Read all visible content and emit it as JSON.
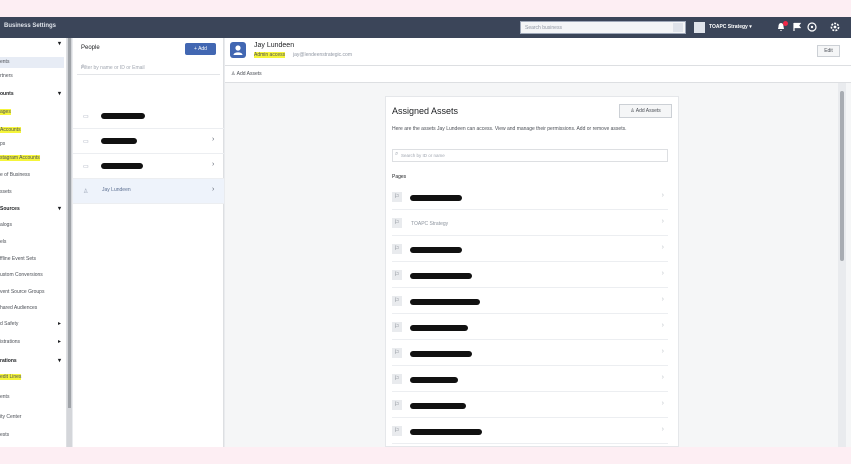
{
  "app": {
    "title": "Business Settings"
  },
  "topbar": {
    "search_placeholder": "Search business",
    "business_name": "TOAPC Strategy",
    "icons": [
      "chevron-down-icon",
      "notifications-icon",
      "flag-icon",
      "help-icon",
      "settings-icon"
    ]
  },
  "sidebar": {
    "items": [
      {
        "label": "",
        "head": true,
        "chev": "▾"
      },
      {
        "label": "ents",
        "active": true
      },
      {
        "label": "rtners"
      },
      {
        "label": "ounts",
        "head": true,
        "chev": "▾"
      },
      {
        "label": "ages",
        "highlight": true
      },
      {
        "label": "Accounts",
        "highlight": true
      },
      {
        "label": "ps"
      },
      {
        "label": "stagram Accounts",
        "highlight": true
      },
      {
        "label": "e of Business"
      },
      {
        "label": "ssets"
      },
      {
        "label": "Sources",
        "head": true,
        "chev": "▾"
      },
      {
        "label": "alogs"
      },
      {
        "label": "els"
      },
      {
        "label": "ffline Event Sets"
      },
      {
        "label": "ustom Conversions"
      },
      {
        "label": "vent Source Groups"
      },
      {
        "label": "hared Audiences"
      },
      {
        "label": "d Safety",
        "chev": "▸"
      },
      {
        "label": "istrations",
        "chev": "▸"
      },
      {
        "label": "rations",
        "head": true,
        "chev": "▾"
      },
      {
        "label": "edit Lines",
        "highlight": true
      },
      {
        "label": "ents"
      },
      {
        "label": "ity Center"
      },
      {
        "label": "ests"
      }
    ]
  },
  "people_panel": {
    "title": "People",
    "add_label": "+ Add",
    "filter_placeholder": "Filter by name or ID or Email",
    "people": [
      {
        "name": "",
        "redacted": true
      },
      {
        "name": "",
        "redacted": true
      },
      {
        "name": "",
        "redacted": true
      },
      {
        "name": "Jay Lundeen",
        "redacted": false,
        "selected": true
      }
    ]
  },
  "detail": {
    "name": "Jay Lundeen",
    "access": "Admin access",
    "email": "jay@lendeenstrategic.com",
    "edit_label": "Edit",
    "add_assets_link": "Add Assets",
    "card": {
      "title": "Assigned Assets",
      "add_button": "Add Assets",
      "description": "Here are the assets Jay Lundeen can access. View and manage their permissions. Add or remove assets.",
      "search_placeholder": "Search by ID or name",
      "section_label": "Pages",
      "pages": [
        {
          "label": "",
          "redacted": true
        },
        {
          "label": "TOAPC Strategy",
          "redacted": false
        },
        {
          "label": "",
          "redacted": true
        },
        {
          "label": "",
          "redacted": true
        },
        {
          "label": "",
          "redacted": true
        },
        {
          "label": "",
          "redacted": true
        },
        {
          "label": "",
          "redacted": true
        },
        {
          "label": "",
          "redacted": true
        },
        {
          "label": "",
          "redacted": true
        },
        {
          "label": "",
          "redacted": true
        }
      ]
    }
  },
  "colors": {
    "topbar": "#3b4559",
    "accent": "#4267b2",
    "highlight": "#f5f53a",
    "redaction": "#111111"
  }
}
